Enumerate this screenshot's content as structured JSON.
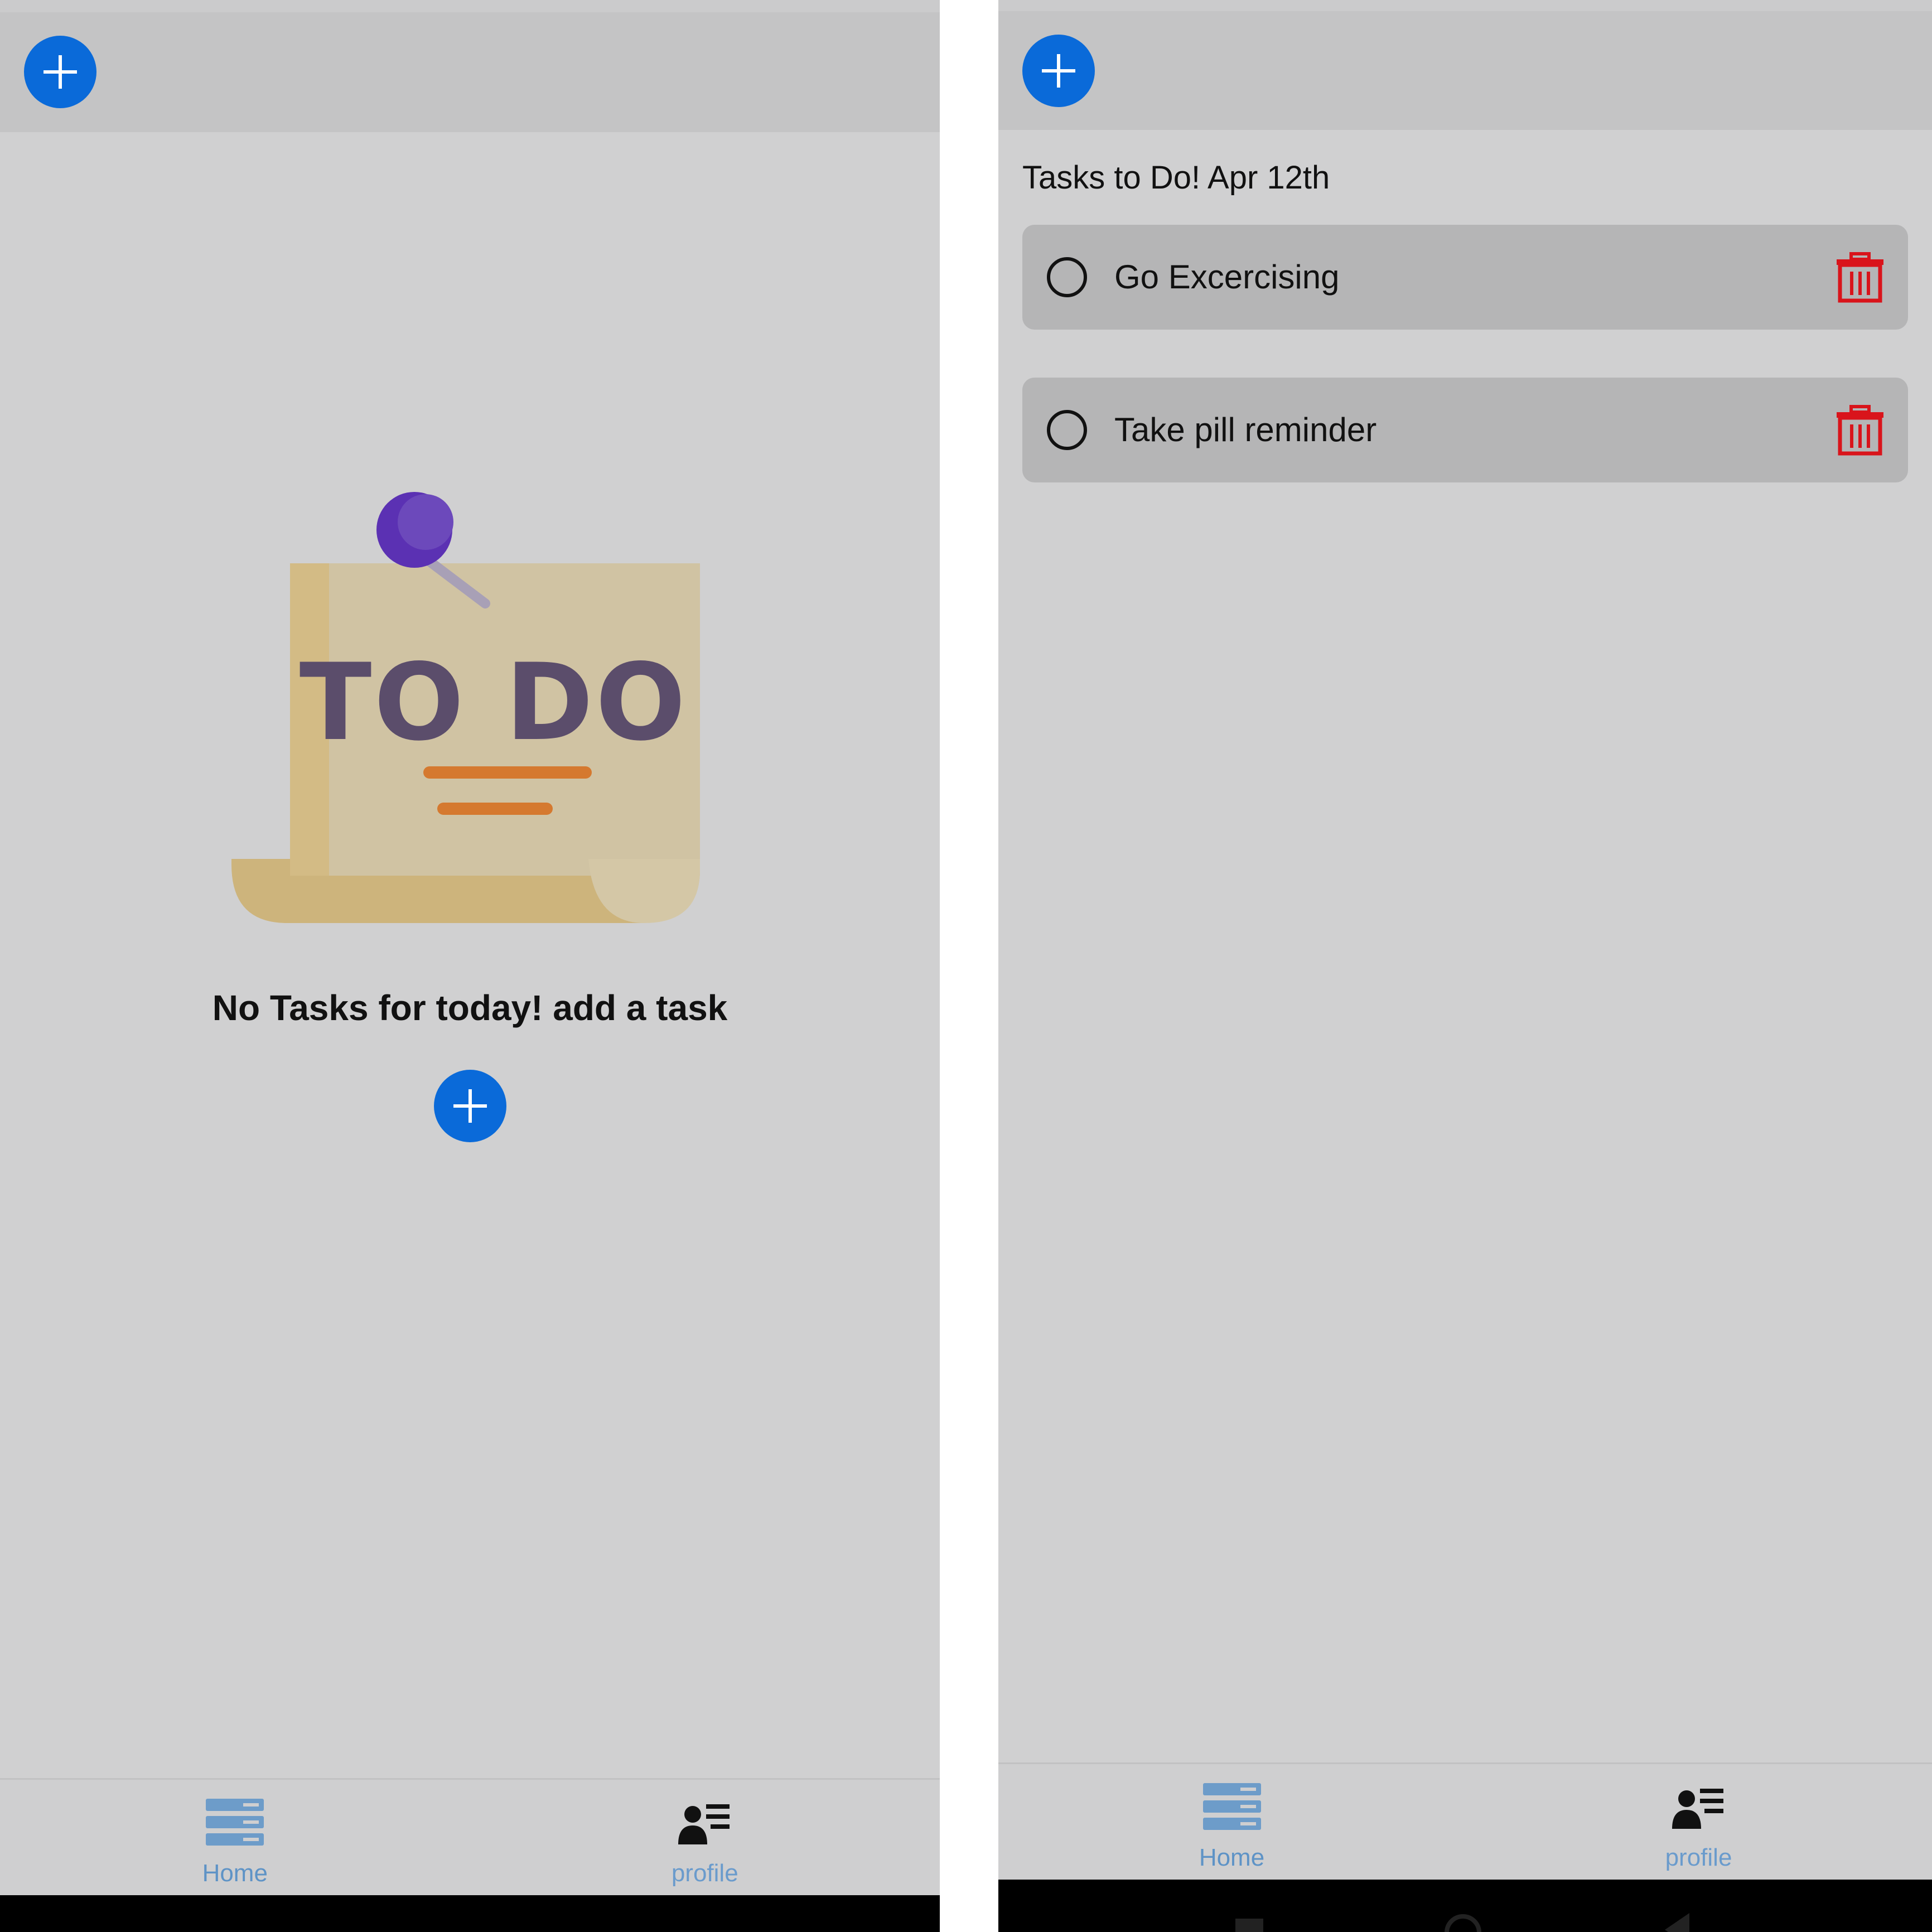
{
  "colors": {
    "accent": "#0a6ad9",
    "delete": "#d9141b",
    "nav_label": "#5e93c6"
  },
  "left_screen": {
    "header": {
      "add_button_icon": "plus-icon"
    },
    "empty_state": {
      "illustration_text": "TO DO",
      "message": "No Tasks for today! add a task",
      "add_button_icon": "plus-icon"
    },
    "bottom_nav": {
      "items": [
        {
          "label": "Home",
          "icon": "list-stack-icon"
        },
        {
          "label": "profile",
          "icon": "user-list-icon"
        }
      ]
    }
  },
  "right_screen": {
    "header": {
      "add_button_icon": "plus-icon"
    },
    "section_title": "Tasks to Do! Apr 12th",
    "tasks": [
      {
        "label": "Go Excercising",
        "done": false
      },
      {
        "label": "Take pill reminder",
        "done": false
      }
    ],
    "bottom_nav": {
      "items": [
        {
          "label": "Home",
          "icon": "list-stack-icon"
        },
        {
          "label": "profile",
          "icon": "user-list-icon"
        }
      ]
    }
  }
}
